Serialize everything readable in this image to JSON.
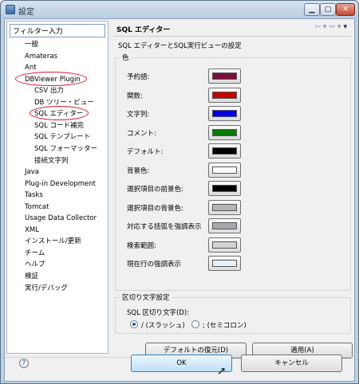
{
  "window": {
    "title": "設定"
  },
  "filter": {
    "placeholder": "フィルター入力"
  },
  "tree": [
    {
      "label": "一般",
      "level": 0
    },
    {
      "label": "Amateras",
      "level": 0
    },
    {
      "label": "Ant",
      "level": 0
    },
    {
      "label": "DBViewer Plugin",
      "level": 0,
      "circled": true
    },
    {
      "label": "CSV 出力",
      "level": 1
    },
    {
      "label": "DB ツリー・ビュー",
      "level": 1
    },
    {
      "label": "SQL エディター",
      "level": 1,
      "selected": true,
      "circled": true
    },
    {
      "label": "SQL コード補完",
      "level": 1
    },
    {
      "label": "SQL テンプレート",
      "level": 1
    },
    {
      "label": "SQL フォーマッター",
      "level": 1
    },
    {
      "label": "接続文字列",
      "level": 1
    },
    {
      "label": "Java",
      "level": 0
    },
    {
      "label": "Plug-in Development",
      "level": 0
    },
    {
      "label": "Tasks",
      "level": 0
    },
    {
      "label": "Tomcat",
      "level": 0
    },
    {
      "label": "Usage Data Collector",
      "level": 0
    },
    {
      "label": "XML",
      "level": 0
    },
    {
      "label": "インストール/更新",
      "level": 0
    },
    {
      "label": "チーム",
      "level": 0
    },
    {
      "label": "ヘルプ",
      "level": 0
    },
    {
      "label": "検証",
      "level": 0
    },
    {
      "label": "実行/デバッグ",
      "level": 0
    }
  ],
  "page": {
    "title": "SQL エディター",
    "description": "SQL エディターとSQL実行ビューの設定",
    "color_group": "色",
    "colors": [
      {
        "label": "予約語:",
        "color": "#7a0e3a"
      },
      {
        "label": "関数:",
        "color": "#c80000"
      },
      {
        "label": "文字列:",
        "color": "#0000e6"
      },
      {
        "label": "コメント:",
        "color": "#0a7a0a"
      },
      {
        "label": "デフォルト:",
        "color": "#000000"
      },
      {
        "label": "背景色:",
        "color": "#ffffff"
      },
      {
        "label": "選択項目の前景色:",
        "color": "#000000"
      },
      {
        "label": "選択項目の背景色:",
        "color": "#b4b4b8"
      },
      {
        "label": "対応する括弧を強調表示",
        "color": "#a8a8ac"
      },
      {
        "label": "検索範囲:",
        "color": "#d4d0d6"
      },
      {
        "label": "現在行の強調表示",
        "color": "#e6f0fa"
      }
    ],
    "delimiter_group": "区切り文字設定",
    "delimiter_label": "SQL 区切り文字(D):",
    "options": [
      {
        "label": "/ (スラッシュ)",
        "checked": true
      },
      {
        "label": "; (セミコロン)",
        "checked": false
      }
    ],
    "restore_defaults": "デフォルトの復元(D)",
    "apply": "適用(A)"
  },
  "footer": {
    "help": "?",
    "ok": "OK",
    "cancel": "キャンセル"
  }
}
